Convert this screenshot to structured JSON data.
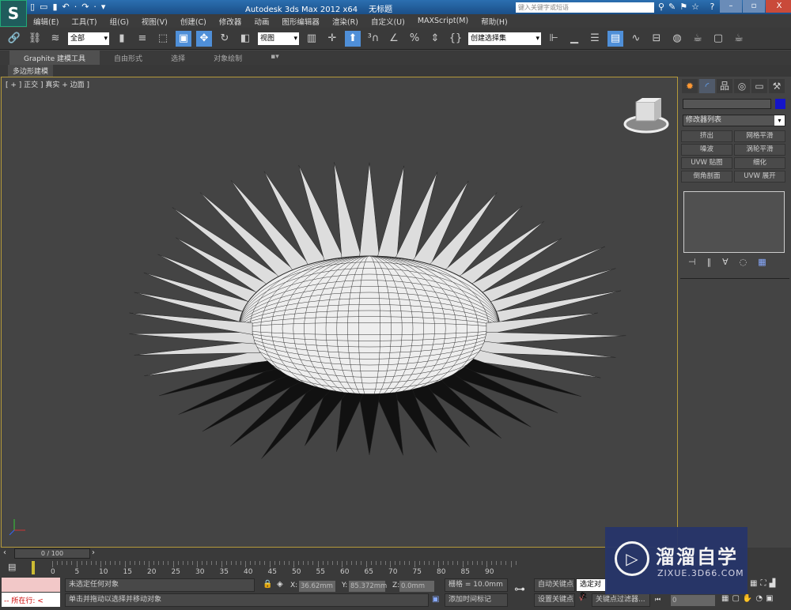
{
  "titlebar": {
    "app": "Autodesk 3ds Max  2012 x64",
    "doc": "无标题",
    "search_placeholder": "键入关键字或短语",
    "logo": "S"
  },
  "menu": [
    "编辑(E)",
    "工具(T)",
    "组(G)",
    "视图(V)",
    "创建(C)",
    "修改器",
    "动画",
    "图形编辑器",
    "渲染(R)",
    "自定义(U)",
    "MAXScript(M)",
    "帮助(H)"
  ],
  "toolbar": {
    "selection_filter": "全部",
    "ref_coord": "视图",
    "named_selection": "创建选择集"
  },
  "ribbon": {
    "tabs": [
      "Graphite 建模工具",
      "自由形式",
      "选择",
      "对象绘制"
    ],
    "active": 0,
    "sub": "多边形建模"
  },
  "viewport": {
    "label": "[ + ] 正交 ] 真实 + 边面 ]"
  },
  "panel": {
    "modifier_list": "修改器列表",
    "object_color": "#1515c8",
    "buttons": [
      "挤出",
      "网格平滑",
      "噪波",
      "涡轮平滑",
      "UVW 贴图",
      "细化",
      "倒角剖面",
      "UVW 展开"
    ]
  },
  "timeline": {
    "frame": "0 / 100",
    "ticks": [
      "0",
      "5",
      "10",
      "15",
      "20",
      "25",
      "30",
      "35",
      "40",
      "45",
      "50",
      "55",
      "60",
      "65",
      "70",
      "75",
      "80",
      "85",
      "90"
    ]
  },
  "status": {
    "listener": "所在行:",
    "selection": "未选定任何对象",
    "prompt": "单击并拖动以选择并移动对象",
    "x_label": "X:",
    "x": "36.62mm",
    "y_label": "Y:",
    "y": "85.372mm",
    "z_label": "Z:",
    "z": "0.0mm",
    "grid": "栅格 = 10.0mm",
    "add_time_tag": "添加时间标记",
    "auto_key": "自动关键点",
    "set_key": "设置关键点",
    "key_mode": "选定对象",
    "key_filters": "关键点过滤器...",
    "frame": "0"
  },
  "watermark": {
    "name": "溜溜自学",
    "url": "ZIXUE.3D66.COM"
  }
}
